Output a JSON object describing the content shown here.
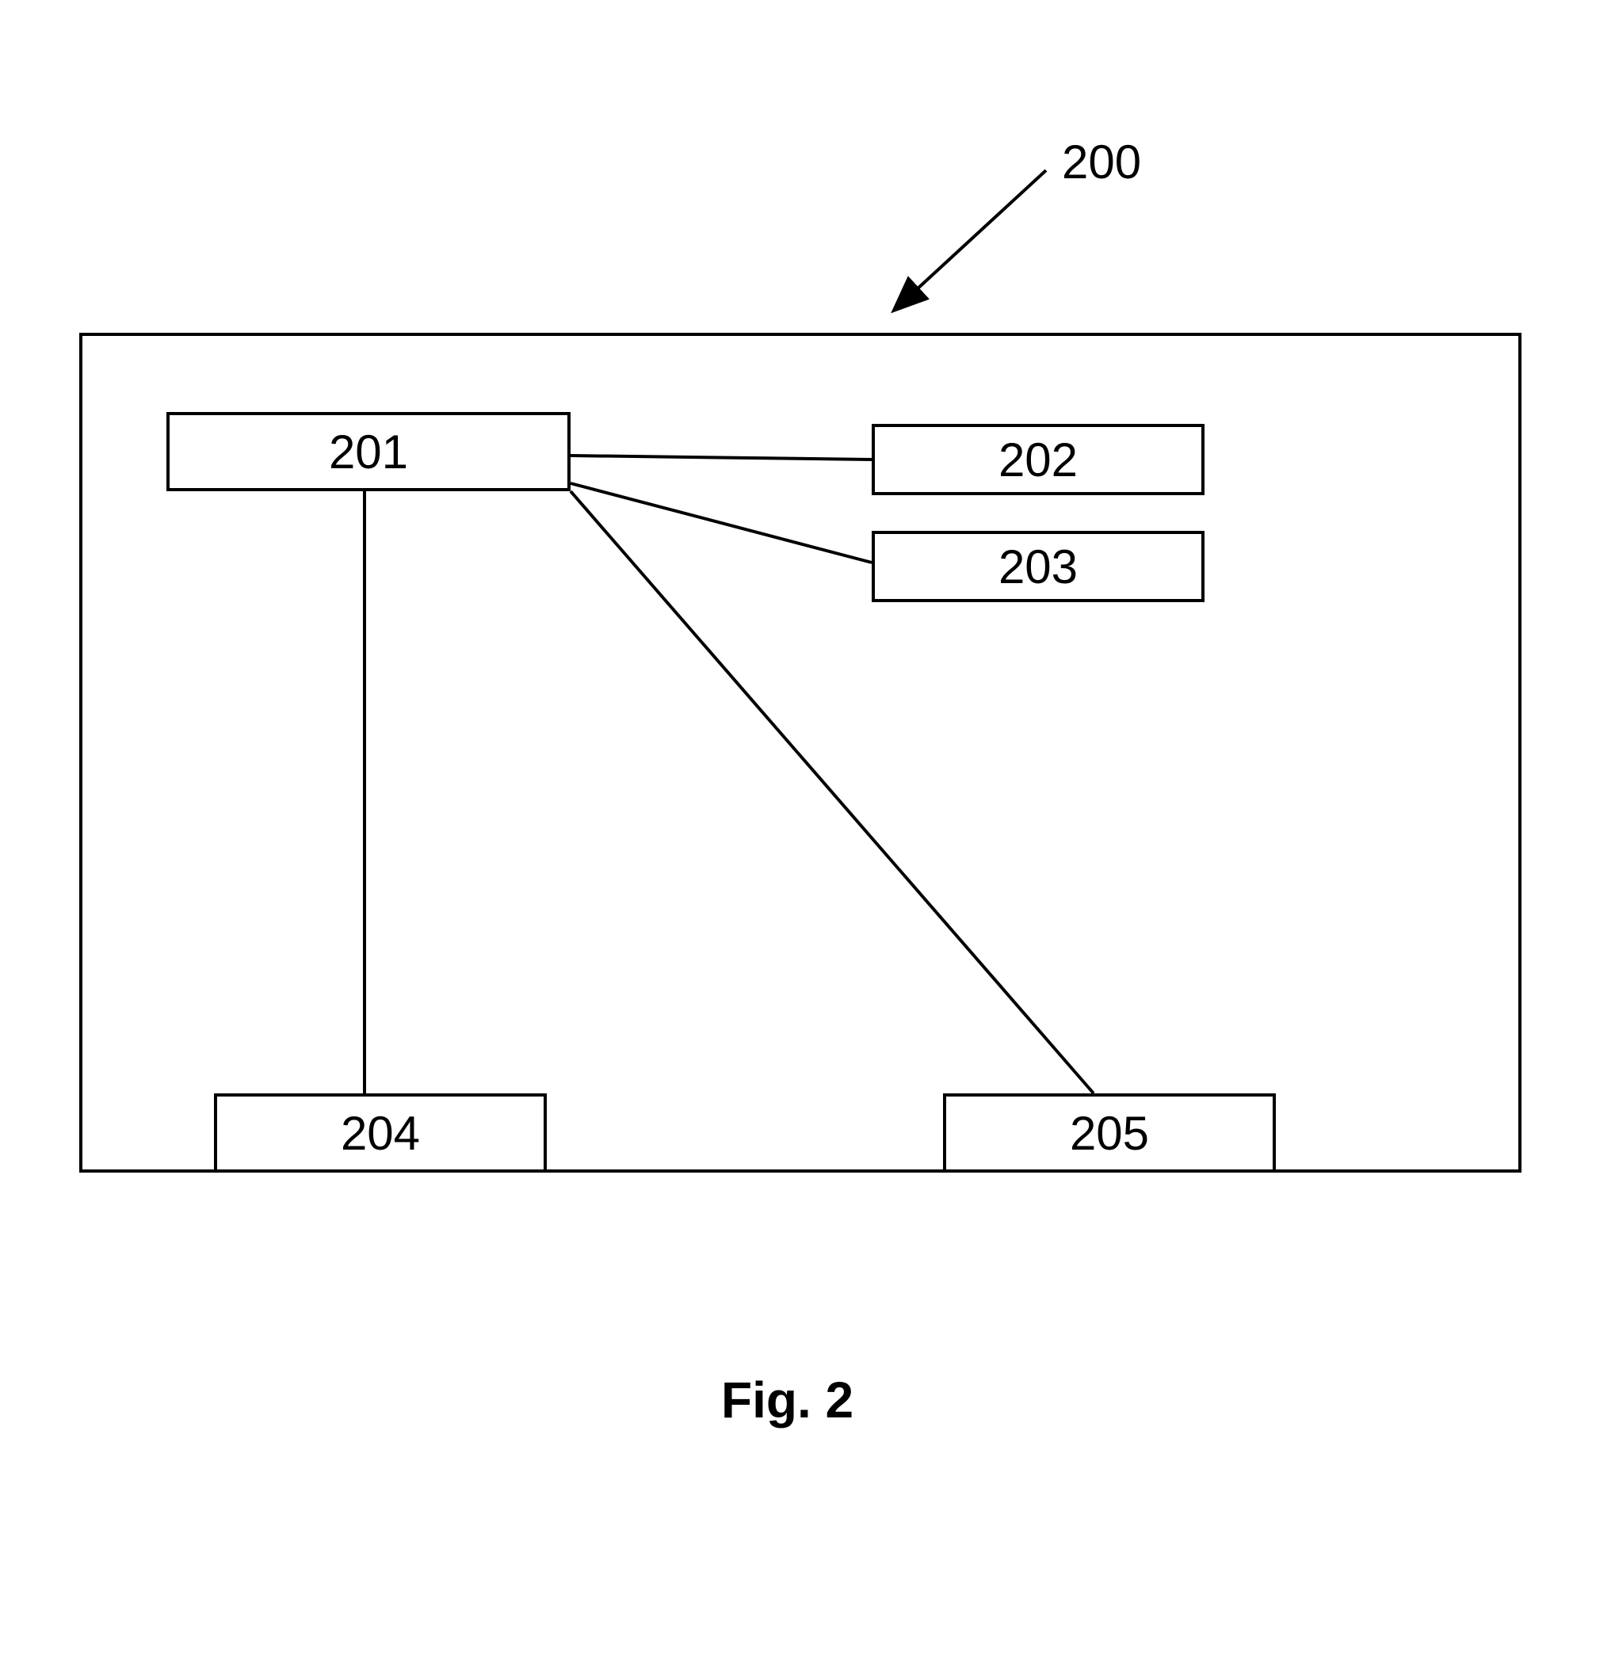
{
  "figure_label_ref": "200",
  "outer_box_ref": "200",
  "nodes": {
    "n201": "201",
    "n202": "202",
    "n203": "203",
    "n204": "204",
    "n205": "205"
  },
  "caption": "Fig. 2"
}
